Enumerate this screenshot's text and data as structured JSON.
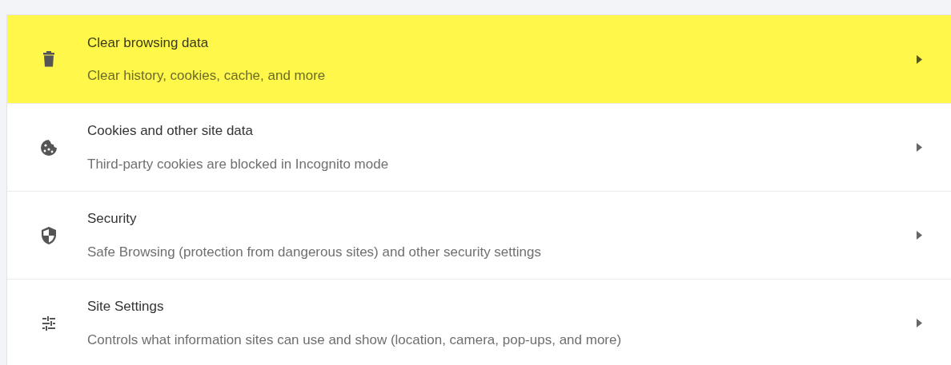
{
  "items": [
    {
      "title": "Clear browsing data",
      "subtitle": "Clear history, cookies, cache, and more",
      "highlighted": true
    },
    {
      "title": "Cookies and other site data",
      "subtitle": "Third-party cookies are blocked in Incognito mode",
      "highlighted": false
    },
    {
      "title": "Security",
      "subtitle": "Safe Browsing (protection from dangerous sites) and other security settings",
      "highlighted": false
    },
    {
      "title": "Site Settings",
      "subtitle": "Controls what information sites can use and show (location, camera, pop-ups, and more)",
      "highlighted": false
    }
  ]
}
